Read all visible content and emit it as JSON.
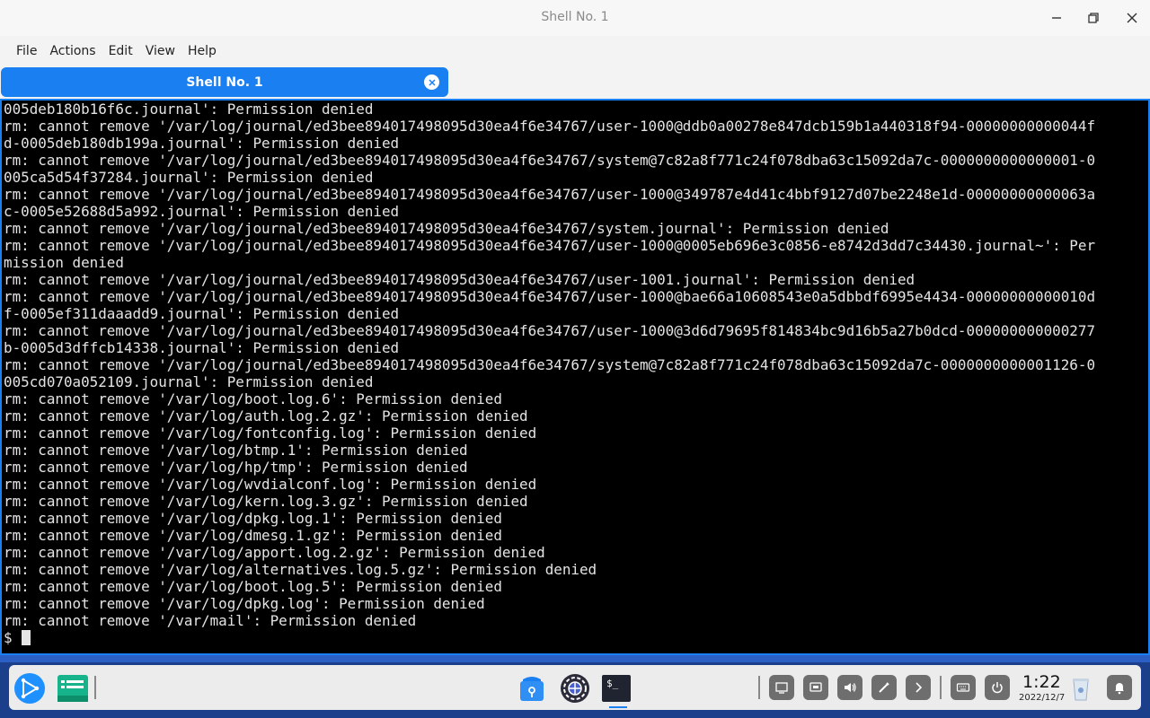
{
  "window": {
    "title": "Shell No. 1"
  },
  "menu": [
    "File",
    "Actions",
    "Edit",
    "View",
    "Help"
  ],
  "tab": {
    "label": "Shell No. 1"
  },
  "terminal": {
    "lines": [
      "005deb180b16f6c.journal': Permission denied",
      "rm: cannot remove '/var/log/journal/ed3bee894017498095d30ea4f6e34767/user-1000@ddb0a00278e847dcb159b1a440318f94-00000000000044f",
      "d-0005deb180db199a.journal': Permission denied",
      "rm: cannot remove '/var/log/journal/ed3bee894017498095d30ea4f6e34767/system@7c82a8f771c24f078dba63c15092da7c-0000000000000001-0",
      "005ca5d54f37284.journal': Permission denied",
      "rm: cannot remove '/var/log/journal/ed3bee894017498095d30ea4f6e34767/user-1000@349787e4d41c4bbf9127d07be2248e1d-00000000000063a",
      "c-0005e52688d5a992.journal': Permission denied",
      "rm: cannot remove '/var/log/journal/ed3bee894017498095d30ea4f6e34767/system.journal': Permission denied",
      "rm: cannot remove '/var/log/journal/ed3bee894017498095d30ea4f6e34767/user-1000@0005eb696e3c0856-e8742d3dd7c34430.journal~': Per",
      "mission denied",
      "rm: cannot remove '/var/log/journal/ed3bee894017498095d30ea4f6e34767/user-1001.journal': Permission denied",
      "rm: cannot remove '/var/log/journal/ed3bee894017498095d30ea4f6e34767/user-1000@bae66a10608543e0a5dbbdf6995e4434-00000000000010d",
      "f-0005ef311daaadd9.journal': Permission denied",
      "rm: cannot remove '/var/log/journal/ed3bee894017498095d30ea4f6e34767/user-1000@3d6d79695f814834bc9d16b5a27b0dcd-000000000000277",
      "b-0005d3dffcb14338.journal': Permission denied",
      "rm: cannot remove '/var/log/journal/ed3bee894017498095d30ea4f6e34767/system@7c82a8f771c24f078dba63c15092da7c-0000000000001126-0",
      "005cd070a052109.journal': Permission denied",
      "rm: cannot remove '/var/log/boot.log.6': Permission denied",
      "rm: cannot remove '/var/log/auth.log.2.gz': Permission denied",
      "rm: cannot remove '/var/log/fontconfig.log': Permission denied",
      "rm: cannot remove '/var/log/btmp.1': Permission denied",
      "rm: cannot remove '/var/log/hp/tmp': Permission denied",
      "rm: cannot remove '/var/log/wvdialconf.log': Permission denied",
      "rm: cannot remove '/var/log/kern.log.3.gz': Permission denied",
      "rm: cannot remove '/var/log/dpkg.log.1': Permission denied",
      "rm: cannot remove '/var/log/dmesg.1.gz': Permission denied",
      "rm: cannot remove '/var/log/apport.log.2.gz': Permission denied",
      "rm: cannot remove '/var/log/alternatives.log.5.gz': Permission denied",
      "rm: cannot remove '/var/log/boot.log.5': Permission denied",
      "rm: cannot remove '/var/log/dpkg.log': Permission denied",
      "rm: cannot remove '/var/mail': Permission denied"
    ],
    "prompt": "$"
  },
  "taskbar": {
    "clock_time": "1:22",
    "clock_date": "2022/12/7",
    "terminal_icon_glyph": "$_",
    "icons": [
      "launcher-icon",
      "file-manager-icon",
      "app-store-icon",
      "system-settings-icon",
      "terminal-icon"
    ],
    "tray": [
      "screen-icon",
      "display-icon",
      "volume-icon",
      "pen-icon",
      "chevron-right-icon",
      "keyboard-icon",
      "power-icon",
      "trash-icon",
      "notification-bell-icon"
    ]
  },
  "colors": {
    "accent": "#1a7ff0",
    "terminal_bg": "#000000",
    "terminal_fg": "#e4e4e4",
    "desktop_bg": "#1c3f8c"
  }
}
